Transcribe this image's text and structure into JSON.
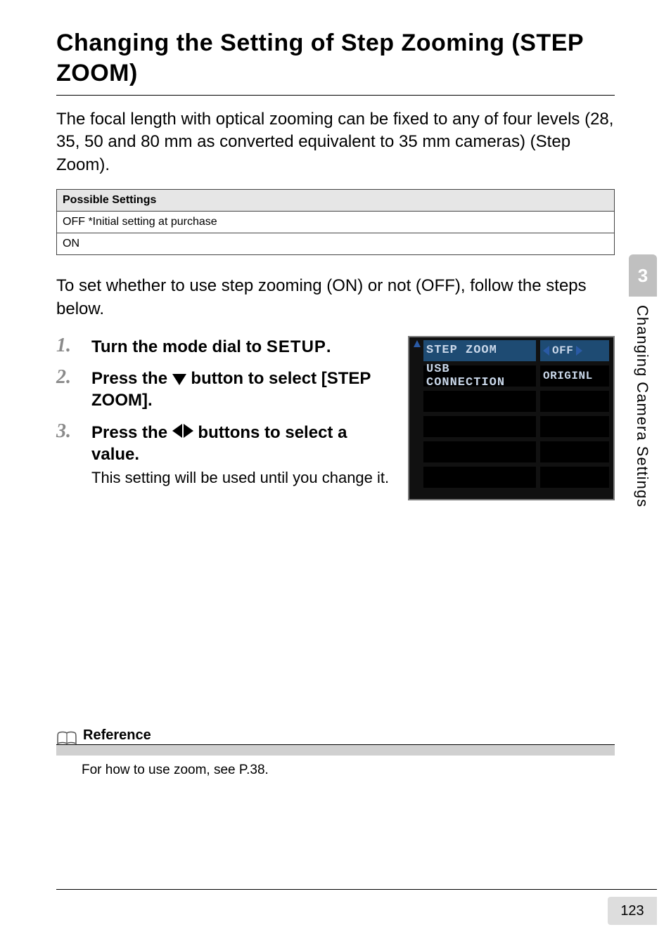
{
  "page": {
    "heading": "Changing the Setting of Step Zooming (STEP ZOOM)",
    "intro": "The focal length with optical zooming can be fixed to any of four levels (28, 35, 50 and 80 mm as converted equivalent to 35 mm cameras) (Step Zoom).",
    "settings_table": {
      "header": "Possible Settings",
      "rows": [
        "OFF *Initial setting at purchase",
        "ON"
      ]
    },
    "paragraph": "To set whether to use step zooming (ON) or not (OFF),  follow the steps below.",
    "steps": [
      {
        "prefix": "Turn the mode dial to ",
        "mode_word": "SETUP",
        "suffix": "."
      },
      {
        "prefix": "Press the ",
        "suffix": " button to select [STEP ZOOM]."
      },
      {
        "prefix": "Press the ",
        "suffix": " buttons to select a value.",
        "body": "This setting will be used until you change it."
      }
    ],
    "lcd": {
      "rows": [
        {
          "label": "STEP ZOOM",
          "value": "OFF",
          "selected": true
        },
        {
          "label": "USB CONNECTION",
          "value": "ORIGINL",
          "selected": false
        },
        {
          "label": "",
          "value": "",
          "selected": false
        },
        {
          "label": "",
          "value": "",
          "selected": false
        },
        {
          "label": "",
          "value": "",
          "selected": false
        },
        {
          "label": "",
          "value": "",
          "selected": false
        }
      ]
    },
    "reference": {
      "title": "Reference",
      "body": "For how to use zoom, see P.38."
    },
    "side_tab": {
      "number": "3",
      "text": "Changing Camera Settings"
    },
    "page_number": "123"
  }
}
